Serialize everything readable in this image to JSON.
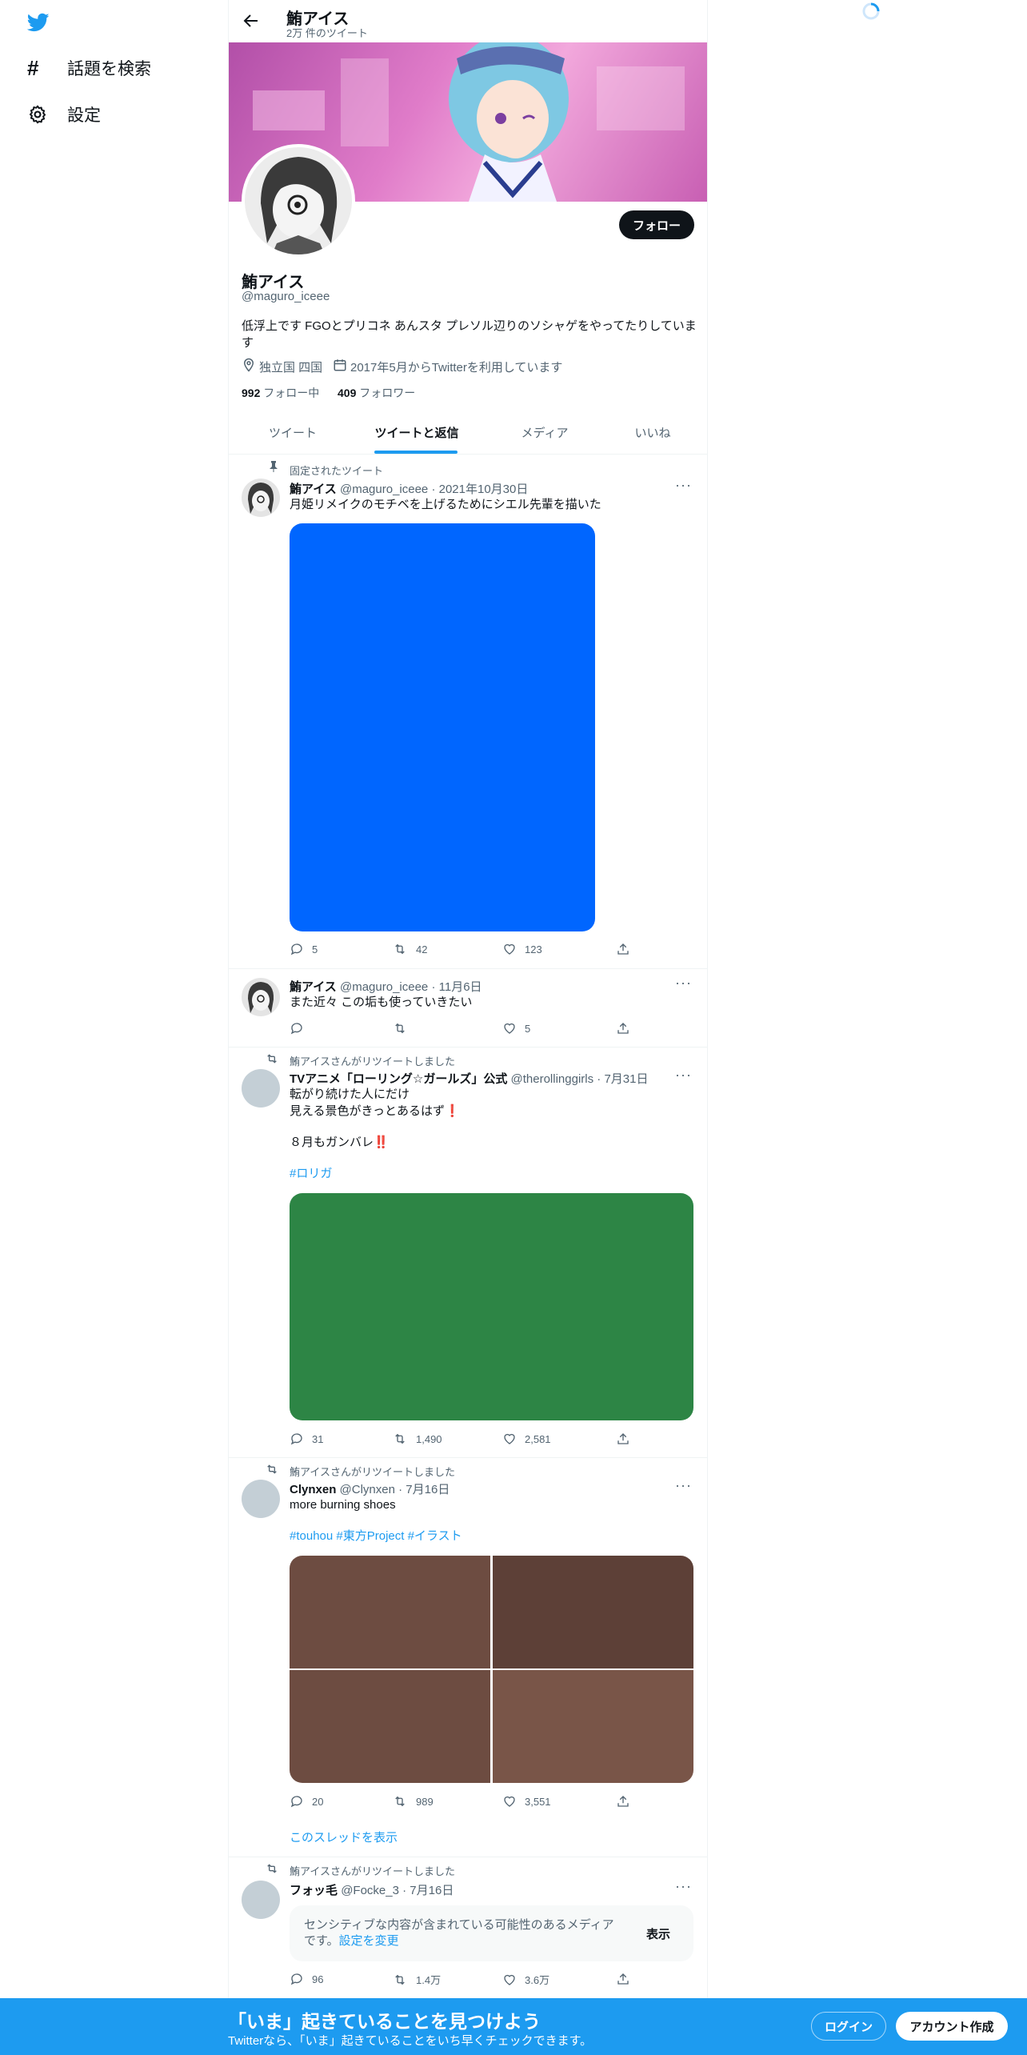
{
  "nav": {
    "explore_label": "話題を検索",
    "settings_label": "設定"
  },
  "header": {
    "name": "鮪アイス",
    "tweet_count": "2万 件のツイート"
  },
  "profile": {
    "follow_label": "フォロー",
    "name": "鮪アイス",
    "handle": "@maguro_iceee",
    "bio_line1": "低浮上です FGOとプリコネ あんスタ プレソル辺りのソシャゲをやってたりしていま",
    "bio_line2": "す",
    "location": "独立国 四国",
    "joined": "2017年5月からTwitterを利用しています",
    "following_count": "992",
    "following_label": "フォロー中",
    "followers_count": "409",
    "followers_label": "フォロワー"
  },
  "tabs": [
    "ツイート",
    "ツイートと返信",
    "メディア",
    "いいね"
  ],
  "active_tab": "ツイートと返信",
  "tweets": [
    {
      "context": "固定されたツイート",
      "name": "鮪アイス",
      "handle": "@maguro_iceee",
      "date": "2021年10月30日",
      "text": "月姫リメイクのモチベを上げるためにシエル先輩を描いた",
      "replies": "5",
      "retweets": "42",
      "likes": "123",
      "media_color": "#0066ff"
    },
    {
      "name": "鮪アイス",
      "handle": "@maguro_iceee",
      "date": "11月6日",
      "text": "また近々 この垢も使っていきたい",
      "replies": "",
      "retweets": "",
      "likes": "5"
    },
    {
      "context": "鮪アイスさんがリツイートしました",
      "name": "TVアニメ「ローリング☆ガールズ」公式",
      "handle": "@therollinggirls",
      "date": "7月31日",
      "text_lines": [
        "転がり続けた人にだけ",
        "見える景色がきっとあるはず❗",
        "８月もガンバレ‼️"
      ],
      "hashtags": "#ロリガ",
      "replies": "31",
      "retweets": "1,490",
      "likes": "2,581",
      "media_color": "#2d8545"
    },
    {
      "context": "鮪アイスさんがリツイートしました",
      "name": "Clynxen",
      "handle": "@Clynxen",
      "date": "7月16日",
      "text": "more burning shoes",
      "hashtags": "#touhou #東方Project #イラスト",
      "replies": "20",
      "retweets": "989",
      "likes": "3,551",
      "media_colors": [
        "#6d4c41",
        "#5d4037",
        "#6d4c41",
        "#795548"
      ],
      "thread_link": "このスレッドを表示"
    },
    {
      "context": "鮪アイスさんがリツイートしました",
      "name": "フォッ毛",
      "handle": "@Focke_3",
      "date": "7月16日",
      "sensitive_text": "センシティブな内容が含まれている可能性のあるメディアです。",
      "sensitive_link": "設定を変更",
      "show_label": "表示",
      "replies": "96",
      "retweets": "1.4万",
      "likes": "3.6万"
    }
  ],
  "bottom_bar": {
    "headline": "「いま」起きていることを見つけよう",
    "subtext": "Twitterなら、「いま」起きていることをいち早くチェックできます。",
    "login_label": "ログイン",
    "signup_label": "アカウント作成"
  },
  "colors": {
    "accent": "#1d9bf0",
    "bottom_bar": "#1d9bf0",
    "text": "#0f1419",
    "muted": "#536471"
  }
}
